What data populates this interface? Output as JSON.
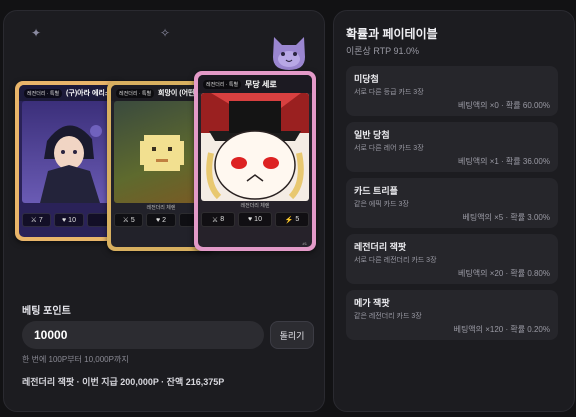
{
  "game": {
    "sparkles": [
      "✦",
      "✧"
    ],
    "mascot_icon": "cat-mascot-icon",
    "cards": [
      {
        "name": "(구)아라 에리스",
        "rarity": "레전더리 · 특별",
        "badge": "",
        "frame_color": "#e9b56a",
        "stats": [
          {
            "icon": "⚔",
            "value": "7"
          },
          {
            "icon": "♥",
            "value": "10"
          },
          {
            "icon": "",
            "value": ""
          }
        ],
        "footer": ""
      },
      {
        "name": "희망이 (어떤 무당",
        "rarity": "레전더리 · 특별",
        "badge": "레전더리 체렌",
        "frame_color": "#d8b060",
        "stats": [
          {
            "icon": "⚔",
            "value": "5"
          },
          {
            "icon": "♥",
            "value": "2"
          },
          {
            "icon": "",
            "value": ""
          }
        ],
        "footer": ""
      },
      {
        "name": "무당 세로",
        "rarity": "레전더리 · 특별",
        "badge": "레전더리 체렌",
        "frame_color": "#e39ac8",
        "stats": [
          {
            "icon": "⚔",
            "value": "8"
          },
          {
            "icon": "♥",
            "value": "10"
          },
          {
            "icon": "⚡",
            "value": "5"
          }
        ],
        "footer": "#1"
      }
    ],
    "bet": {
      "label": "베팅 포인트",
      "value": "10000",
      "spin_label": "돌리기",
      "hint": "한 번에 100P부터 10,000P까지",
      "result": "레전더리 잭팟 · 이번 지급 200,000P · 잔액 216,375P"
    }
  },
  "paytable": {
    "title": "확률과 페이테이블",
    "rtp": "이론상 RTP 91.0%",
    "rows": [
      {
        "name": "미당첨",
        "desc": "서로 다른 등급 카드 3장",
        "odds": "베팅액의 ×0 · 확률 60.00%"
      },
      {
        "name": "일반 당첨",
        "desc": "서로 다른 레어 카드 3장",
        "odds": "베팅액의 ×1 · 확률 36.00%"
      },
      {
        "name": "카드 트리플",
        "desc": "같은 에픽 카드 3장",
        "odds": "베팅액의 ×5 · 확률 3.00%"
      },
      {
        "name": "레전더리 잭팟",
        "desc": "서로 다른 레전더리 카드 3장",
        "odds": "베팅액의 ×20 · 확률 0.80%"
      },
      {
        "name": "메가 잭팟",
        "desc": "같은 레전더리 카드 3장",
        "odds": "베팅액의 ×120 · 확률 0.20%"
      }
    ]
  }
}
